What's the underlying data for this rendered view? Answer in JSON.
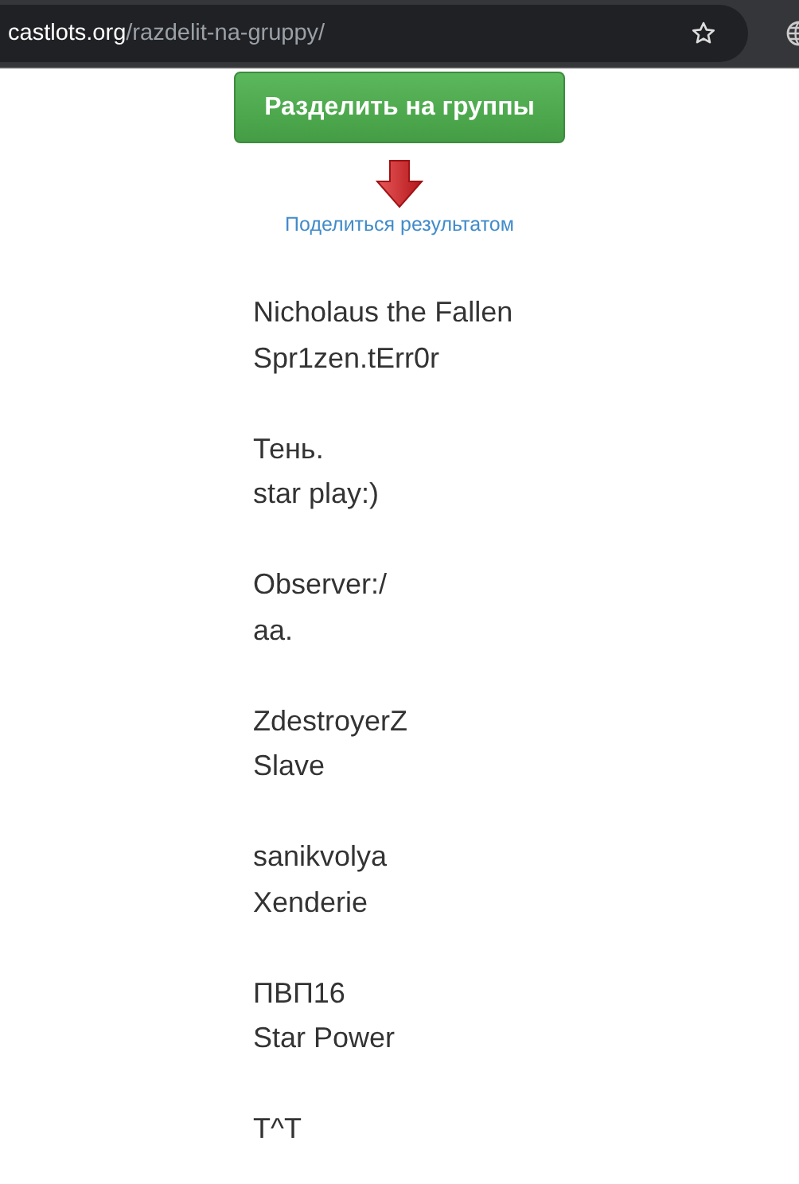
{
  "address_bar": {
    "domain": "castlots.org",
    "path": "/razdelit-na-gruppy/"
  },
  "split_button": "Разделить на группы",
  "share_link": "Поделиться результатом",
  "groups": [
    [
      "Nicholaus the Fallen",
      "Spr1zen.tErr0r"
    ],
    [
      "Тень.",
      "star play:)"
    ],
    [
      "Observer:/",
      "aa."
    ],
    [
      "ZdestroyerZ",
      "Slave"
    ],
    [
      "sanikvolya",
      "Xenderie"
    ],
    [
      "ПВП16",
      "Star Power"
    ],
    [
      "T^T"
    ]
  ]
}
